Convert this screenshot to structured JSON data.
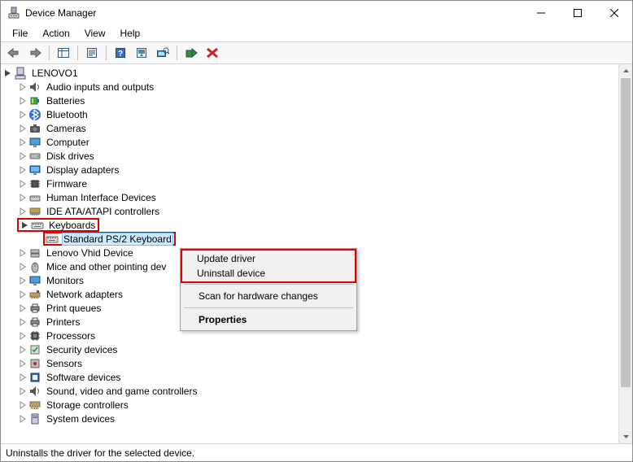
{
  "window": {
    "title": "Device Manager"
  },
  "menu": {
    "file": "File",
    "action": "Action",
    "view": "View",
    "help": "Help"
  },
  "root": {
    "name": "LENOVO1"
  },
  "cat": {
    "audio": "Audio inputs and outputs",
    "batteries": "Batteries",
    "bluetooth": "Bluetooth",
    "cameras": "Cameras",
    "computer": "Computer",
    "disk": "Disk drives",
    "display": "Display adapters",
    "firmware": "Firmware",
    "hid": "Human Interface Devices",
    "ide": "IDE ATA/ATAPI controllers",
    "keyboards": "Keyboards",
    "kb_ps2": "Standard PS/2 Keyboard",
    "lenovo_vhid": "Lenovo Vhid Device",
    "mice": "Mice and other pointing dev",
    "monitors": "Monitors",
    "network": "Network adapters",
    "printq": "Print queues",
    "printers": "Printers",
    "processors": "Processors",
    "security": "Security devices",
    "sensors": "Sensors",
    "software": "Software devices",
    "sound": "Sound, video and game controllers",
    "storage": "Storage controllers",
    "system": "System devices"
  },
  "ctx": {
    "update": "Update driver",
    "uninstall": "Uninstall device",
    "scan": "Scan for hardware changes",
    "properties": "Properties"
  },
  "status": {
    "text": "Uninstalls the driver for the selected device."
  }
}
